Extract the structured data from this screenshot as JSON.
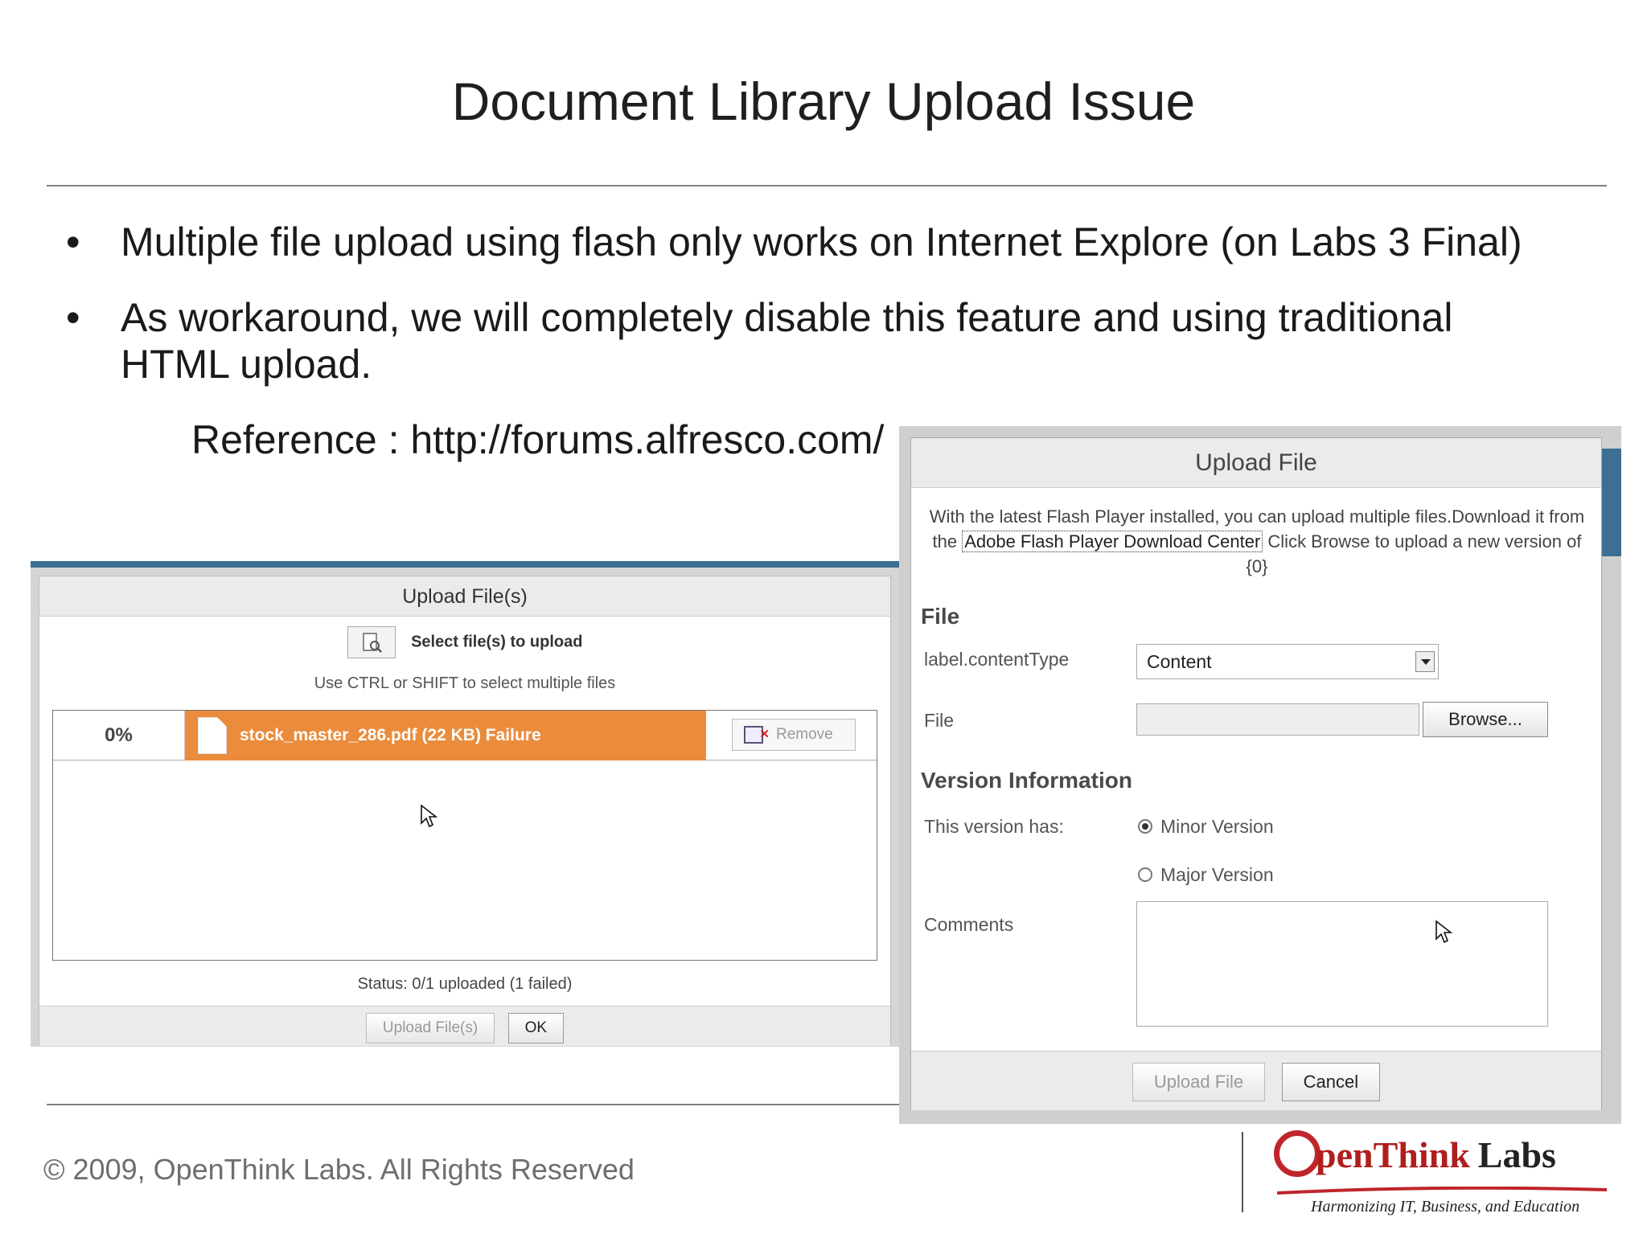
{
  "slide": {
    "title": "Document Library Upload Issue",
    "bullets": [
      "Multiple file upload using flash only works on Internet Explore (on Labs 3 Final)",
      "As workaround, we will completely disable this feature and using traditional HTML upload."
    ],
    "sub_bullet": "Reference : http://forums.alfresco.com/",
    "bullet_symbol": "•",
    "footer_copyright": "© 2009, OpenThink Labs. All Rights Reserved",
    "logo": {
      "name_red": "penThink",
      "name_dark": "Labs",
      "tagline": "Harmonizing IT, Business, and Education"
    }
  },
  "multi_upload_dialog": {
    "title": "Upload File(s)",
    "select_label": "Select file(s) to upload",
    "hint": "Use CTRL or SHIFT to select multiple files",
    "file_row": {
      "progress": "0%",
      "file_text": "stock_master_286.pdf (22 KB) Failure",
      "remove_label": "Remove"
    },
    "status": "Status: 0/1 uploaded (1 failed)",
    "upload_button": "Upload File(s)",
    "ok_button": "OK"
  },
  "single_upload_dialog": {
    "title": "Upload File",
    "desc_before": "With the latest Flash Player installed, you can upload multiple files.Download it from the",
    "desc_link": "Adobe Flash Player Download Center",
    "desc_after": " Click Browse to upload a new version of {0}",
    "file_section": "File",
    "content_type_label": "label.contentType",
    "content_type_value": "Content",
    "file_label": "File",
    "browse_button": "Browse...",
    "version_section": "Version Information",
    "version_has_label": "This version has:",
    "minor_version": "Minor Version",
    "major_version": "Major Version",
    "comments_label": "Comments",
    "upload_button": "Upload File",
    "cancel_button": "Cancel"
  },
  "colors": {
    "failure_row": "#ea8c3c",
    "window_frame_blue": "#3d6f94",
    "logo_red": "#c0252b"
  }
}
